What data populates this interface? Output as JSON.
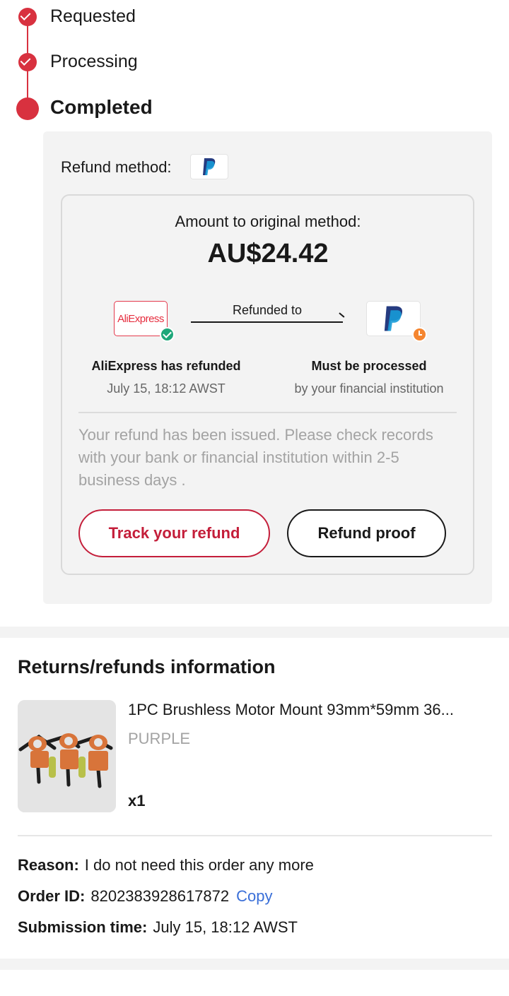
{
  "timeline": {
    "steps": [
      {
        "label": "Requested",
        "state": "done"
      },
      {
        "label": "Processing",
        "state": "done"
      },
      {
        "label": "Completed",
        "state": "current"
      }
    ]
  },
  "refund": {
    "method_label": "Refund method:",
    "method_icon": "paypal-icon",
    "amount_label": "Amount to original method:",
    "amount": "AU$24.42",
    "source_logo": "AliExpress",
    "arrow_label": "Refunded to",
    "from_title": "AliExpress has refunded",
    "from_time": "July 15, 18:12 AWST",
    "to_title": "Must be processed",
    "to_sub": "by your financial institution",
    "notice": "Your refund has been issued. Please check records with your bank or financial institution within 2-5 business days .",
    "track_button": "Track your refund",
    "proof_button": "Refund proof"
  },
  "returns_info": {
    "title": "Returns/refunds information",
    "item": {
      "name": "1PC Brushless Motor Mount 93mm*59mm 36...",
      "variant": "PURPLE",
      "quantity": "x1"
    },
    "reason_key": "Reason:",
    "reason_value": "I do not need this order any more",
    "order_key": "Order ID:",
    "order_value": "8202383928617872",
    "copy_label": "Copy",
    "submission_key": "Submission time:",
    "submission_value": "July 15, 18:12 AWST"
  },
  "colors": {
    "accent_red": "#d8313f",
    "track_red": "#c41e3a",
    "link_blue": "#3a6fd8",
    "check_green": "#1ea77a",
    "clock_orange": "#f5852f"
  }
}
